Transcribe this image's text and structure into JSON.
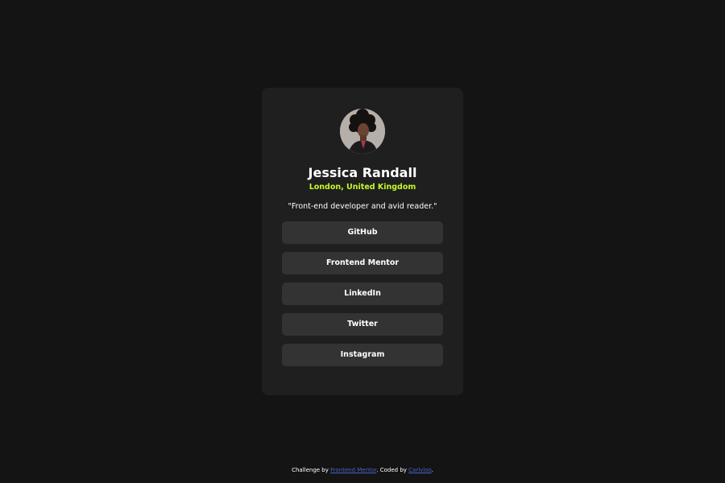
{
  "profile": {
    "name": "Jessica Randall",
    "location": "London, United Kingdom",
    "bio": "\"Front-end developer and avid reader.\""
  },
  "links": [
    {
      "label": "GitHub"
    },
    {
      "label": "Frontend Mentor"
    },
    {
      "label": "LinkedIn"
    },
    {
      "label": "Twitter"
    },
    {
      "label": "Instagram"
    }
  ],
  "attribution": {
    "prefix": "Challenge by ",
    "challenge_link": "Frontend Mentor",
    "middle": ". Coded by ",
    "author_link": "Carlvloo",
    "suffix": "."
  },
  "colors": {
    "background": "#141414",
    "card": "#1f1f1f",
    "button": "#333333",
    "accent": "#c4f82a",
    "link": "#4a63c4"
  }
}
